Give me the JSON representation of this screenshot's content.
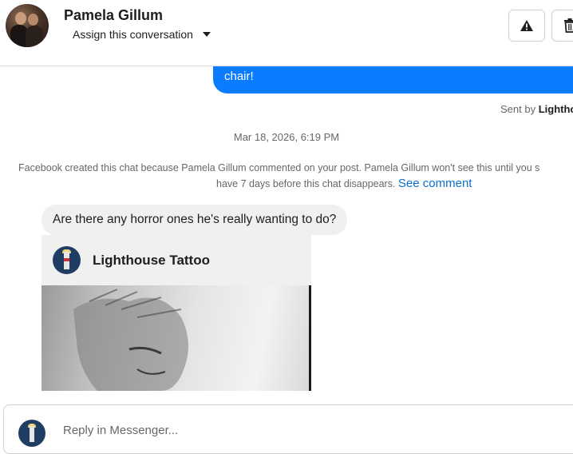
{
  "header": {
    "contact_name": "Pamela Gillum",
    "assign_label": "Assign this conversation",
    "icons": [
      "warning-icon",
      "trash-icon"
    ]
  },
  "messages": {
    "outgoing_text": "chair!",
    "sent_by_prefix": "Sent by ",
    "sent_by_name": "Lighthouse",
    "timestamp": "Mar 18, 2026, 6:19 PM",
    "system_note_line1": "Facebook created this chat because Pamela Gillum commented on your post. Pamela Gillum won't see this until you s",
    "system_note_line2": "have 7 days before this chat disappears. ",
    "see_comment_label": "See comment",
    "incoming_text": "Are there any horror ones he's really wanting to do?",
    "shared_card_title": "Lighthouse Tattoo"
  },
  "reply": {
    "placeholder": "Reply in Messenger..."
  },
  "colors": {
    "outgoing_bubble": "#0a7cff",
    "incoming_bubble": "#f0f0f0",
    "link": "#0a6ec9"
  }
}
